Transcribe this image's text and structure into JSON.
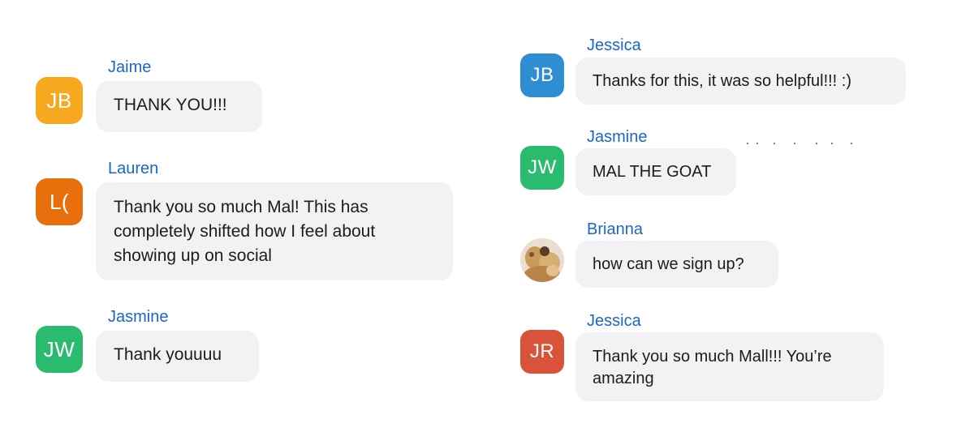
{
  "messages_left": [
    {
      "name": "Jaime",
      "initials": "JB",
      "color": "#f6a81f",
      "text": "THANK YOU!!!"
    },
    {
      "name": "Lauren",
      "initials": "L(",
      "color": "#e8700c",
      "text": "Thank you so much Mal! This has\ncompletely shifted how I feel about\nshowing up on social"
    },
    {
      "name": "Jasmine",
      "initials": "JW",
      "color": "#2bbb6e",
      "text": "Thank youuuu"
    }
  ],
  "messages_right": [
    {
      "name": "Jessica",
      "initials": "JB",
      "color": "#2f8ed1",
      "text": "Thanks for this, it was so helpful!!! :)"
    },
    {
      "name": "Jasmine",
      "initials": "JW",
      "color": "#2bbb6e",
      "text": "MAL THE GOAT"
    },
    {
      "name": "Brianna",
      "avatar_type": "photo",
      "text": "how can we sign up?"
    },
    {
      "name": "Jessica",
      "initials": "JR",
      "color": "#d9533a",
      "text": "Thank you so much Mall!!! You’re\namazing"
    }
  ]
}
